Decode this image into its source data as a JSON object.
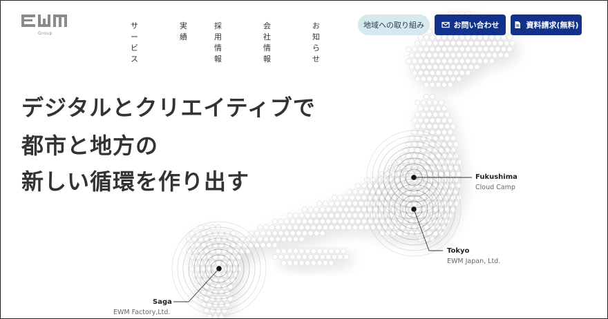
{
  "brand": {
    "logo_text": "EWM",
    "logo_sub": "Group"
  },
  "nav": {
    "items": [
      "サービス",
      "実績",
      "採用情報",
      "会社情報",
      "お知らせ"
    ]
  },
  "buttons": {
    "region": "地域への取り組み",
    "contact": "お問い合わせ",
    "contact_icon": "mail-icon",
    "docs": "資料請求(無料)",
    "docs_icon": "document-icon"
  },
  "colors": {
    "primary": "#12318a",
    "region_bg": "#d5e9ee"
  },
  "hero": {
    "lines": [
      "デジタルとクリエイティブで",
      "都市と地方の",
      "新しい循環を作り出す"
    ]
  },
  "locations": [
    {
      "name": "Fukushima",
      "company": "Cloud Camp"
    },
    {
      "name": "Tokyo",
      "company": "EWM Japan, Ltd."
    },
    {
      "name": "Saga",
      "company": "EWM Factory,Ltd."
    }
  ]
}
